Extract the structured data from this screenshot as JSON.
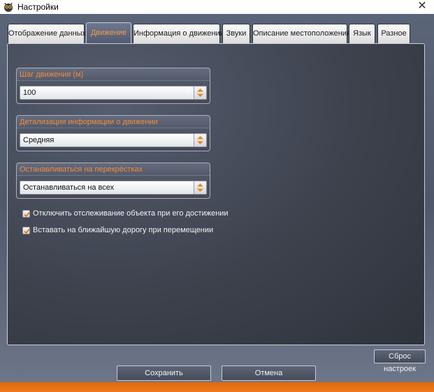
{
  "window": {
    "title": "Настройки"
  },
  "tabs": [
    {
      "label": "Отображение данных",
      "active": false
    },
    {
      "label": "Движение",
      "active": true
    },
    {
      "label": "Информация о движении",
      "active": false
    },
    {
      "label": "Звуки",
      "active": false
    },
    {
      "label": "Описание местоположения",
      "active": false
    },
    {
      "label": "Язык",
      "active": false
    },
    {
      "label": "Разное",
      "active": false
    }
  ],
  "groups": [
    {
      "label": "Шаг движения (м)",
      "value": "100"
    },
    {
      "label": "Детализация информации о движении",
      "value": "Средняя"
    },
    {
      "label": "Останавливаться на перекрёстках",
      "value": "Останавливаться на всех"
    }
  ],
  "checkboxes": [
    {
      "label": "Отключить отслеживание объекта при его достижении",
      "checked": true
    },
    {
      "label": "Вставать на ближайшую дорогу при перемещении",
      "checked": true
    }
  ],
  "buttons": {
    "reset": "Сброс настроек",
    "save": "Сохранить",
    "cancel": "Отмена"
  },
  "colors": {
    "accent": "#f08a3a",
    "bottom_bar": "#e8700f"
  },
  "icons": {
    "app": "owl-icon",
    "close": "close-icon",
    "spinner": "spin-arrows-icon",
    "check": "checkmark-icon"
  }
}
